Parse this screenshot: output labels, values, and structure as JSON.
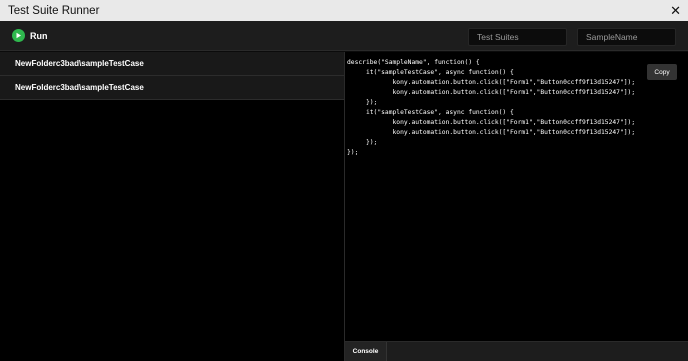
{
  "window": {
    "title": "Test Suite Runner",
    "close_glyph": "✕"
  },
  "toolbar": {
    "run_label": "Run",
    "run_icon": "play-icon",
    "run_color": "#2fb84e",
    "test_suites_placeholder": "Test Suites",
    "sample_name_placeholder": "SampleName"
  },
  "tests": [
    {
      "label": "NewFolderc3bad\\sampleTestCase"
    },
    {
      "label": "NewFolderc3bad\\sampleTestCase"
    }
  ],
  "editor": {
    "copy_label": "Copy",
    "code": "describe(\"SampleName\", function() {\n     it(\"sampleTestCase\", async function() {\n            kony.automation.button.click([\"Form1\",\"Button0ccff9f13d15247\"]);\n            kony.automation.button.click([\"Form1\",\"Button0ccff9f13d15247\"]);\n     });\n     it(\"sampleTestCase\", async function() {\n            kony.automation.button.click([\"Form1\",\"Button0ccff9f13d15247\"]);\n            kony.automation.button.click([\"Form1\",\"Button0ccff9f13d15247\"]);\n     });\n});"
  },
  "console": {
    "tab_label": "Console"
  }
}
